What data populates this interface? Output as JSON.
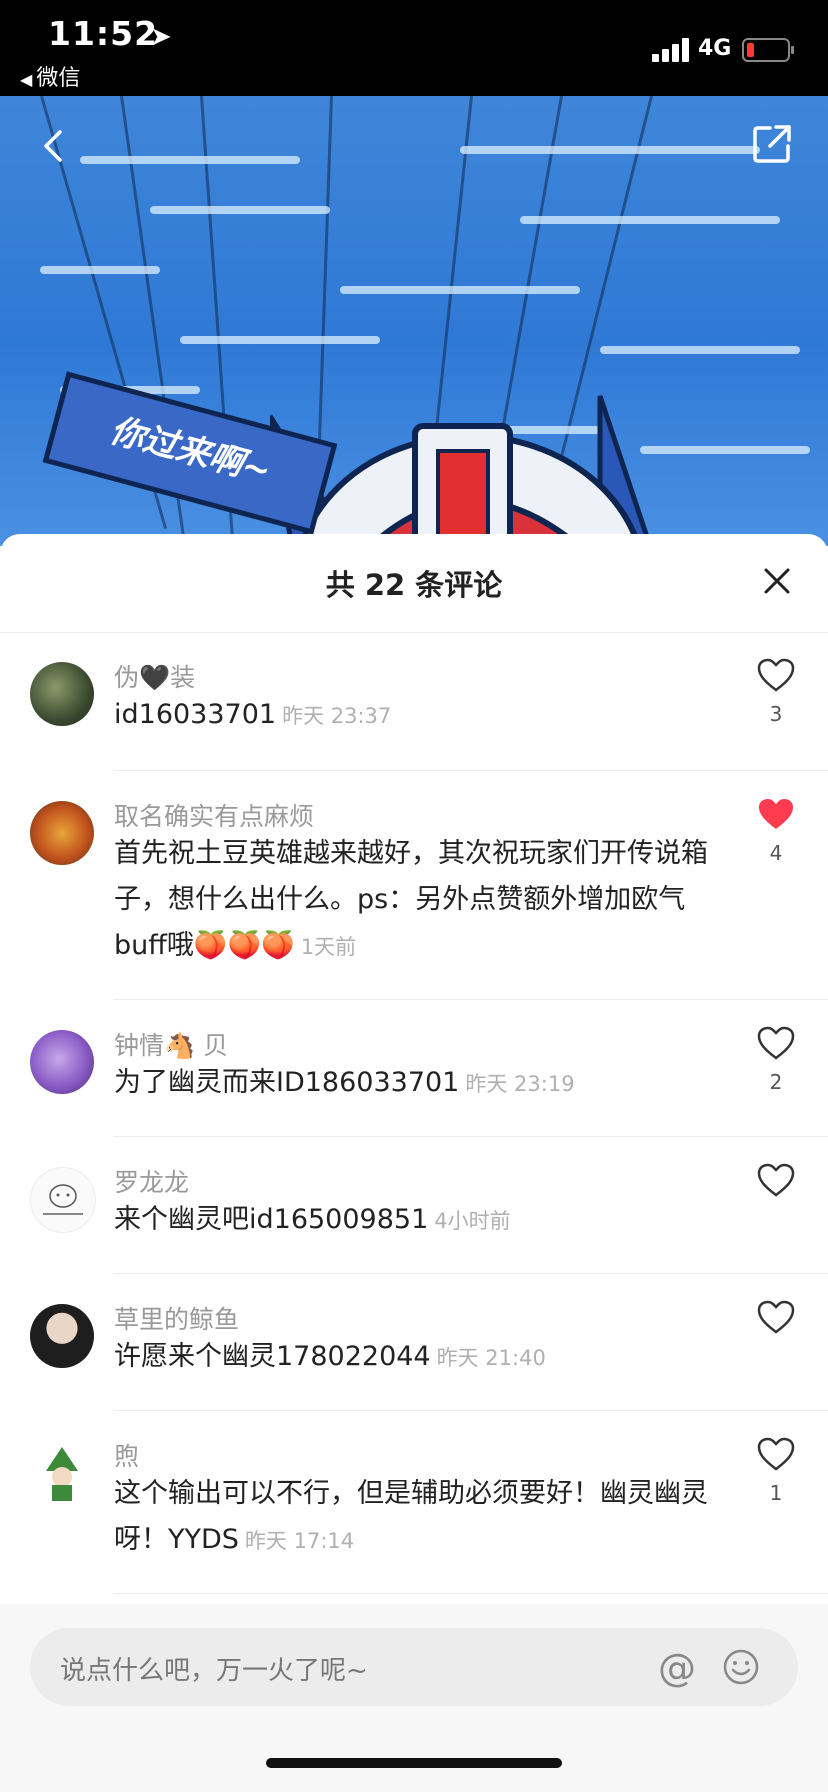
{
  "status_bar": {
    "time": "11:52",
    "location_arrow": "➤",
    "back_app": "微信",
    "network": "4G"
  },
  "hero": {
    "banner_text": "你过来啊~",
    "back_icon": "chevron-left-icon",
    "share_icon": "share-icon"
  },
  "comments_panel": {
    "title": "共 22 条评论",
    "comments": [
      {
        "user": "伪🖤装",
        "text": "id16033701",
        "time": "昨天 23:37",
        "likes": "3",
        "liked": false
      },
      {
        "user": "取名确实有点麻烦",
        "text": "首先祝土豆英雄越来越好，其次祝玩家们开传说箱子，想什么出什么。ps：另外点赞额外增加欧气buff哦🍑🍑🍑",
        "time": "1天前",
        "likes": "4",
        "liked": true
      },
      {
        "user": "钟情🐴 贝",
        "text": "为了幽灵而来ID186033701",
        "time": "昨天 23:19",
        "likes": "2",
        "liked": false
      },
      {
        "user": "罗龙龙",
        "text": "来个幽灵吧id165009851",
        "time": "4小时前",
        "likes": "",
        "liked": false
      },
      {
        "user": "草里的鲸鱼",
        "text": "许愿来个幽灵178022044",
        "time": "昨天 21:40",
        "likes": "",
        "liked": false
      },
      {
        "user": "煦",
        "text": "这个输出可以不行，但是辅助必须要好！幽灵幽灵呀！YYDS",
        "time": "昨天 17:14",
        "likes": "1",
        "liked": false
      }
    ]
  },
  "input": {
    "placeholder": "说点什么吧，万一火了呢~",
    "at_symbol": "@"
  },
  "colors": {
    "liked_heart": "#ff3b4f",
    "muted_text": "#9a9a9a"
  }
}
